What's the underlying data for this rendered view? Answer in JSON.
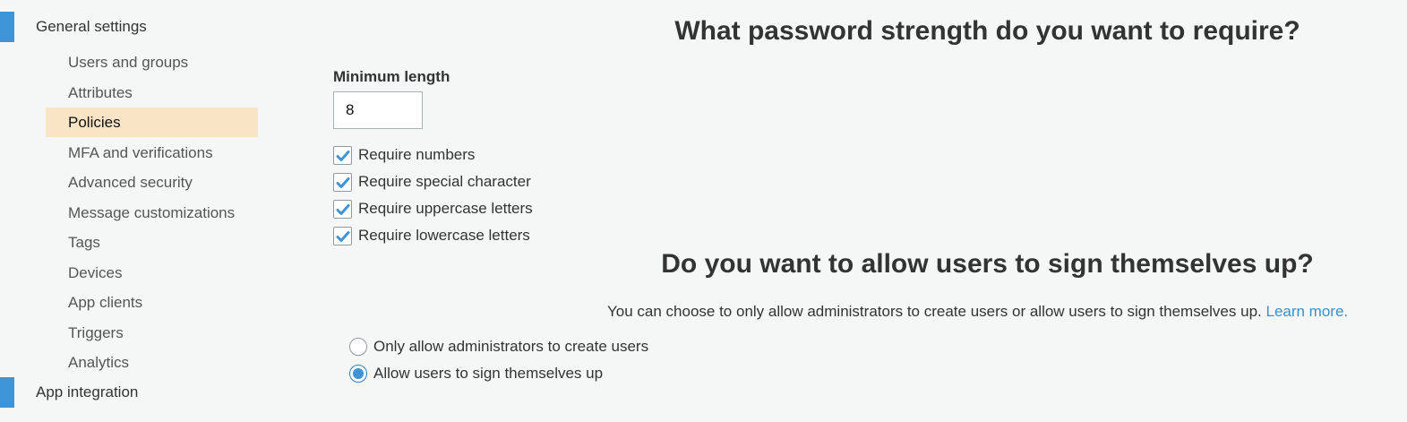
{
  "sidebar": {
    "general_settings": "General settings",
    "items": [
      {
        "label": "Users and groups"
      },
      {
        "label": "Attributes"
      },
      {
        "label": "Policies"
      },
      {
        "label": "MFA and verifications"
      },
      {
        "label": "Advanced security"
      },
      {
        "label": "Message customizations"
      },
      {
        "label": "Tags"
      },
      {
        "label": "Devices"
      },
      {
        "label": "App clients"
      },
      {
        "label": "Triggers"
      },
      {
        "label": "Analytics"
      }
    ],
    "active_item": "Policies",
    "app_integration": "App integration"
  },
  "password": {
    "heading": "What password strength do you want to require?",
    "min_length_label": "Minimum length",
    "min_length_value": "8",
    "options": [
      {
        "label": "Require numbers",
        "checked": true
      },
      {
        "label": "Require special character",
        "checked": true
      },
      {
        "label": "Require uppercase letters",
        "checked": true
      },
      {
        "label": "Require lowercase letters",
        "checked": true
      }
    ]
  },
  "signup": {
    "heading": "Do you want to allow users to sign themselves up?",
    "description": "You can choose to only allow administrators to create users or allow users to sign themselves up.",
    "learn_more": "Learn more.",
    "options": [
      {
        "label": "Only allow administrators to create users",
        "selected": false
      },
      {
        "label": "Allow users to sign themselves up",
        "selected": true
      }
    ]
  },
  "colors": {
    "accent": "#3d94d6",
    "active_bg": "#f9e4c6",
    "link": "#3a90c9"
  }
}
